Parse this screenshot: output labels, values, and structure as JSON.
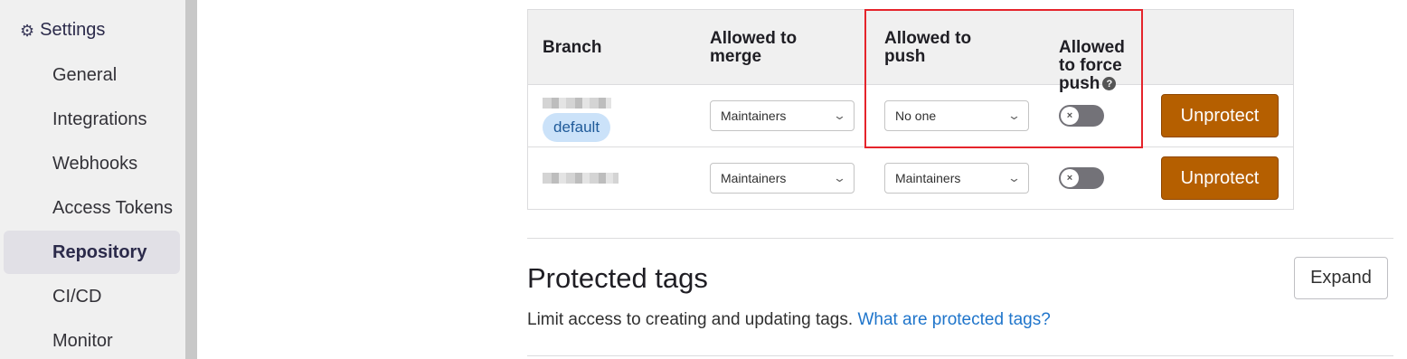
{
  "sidebar": {
    "header": "Settings",
    "items": [
      {
        "label": "General"
      },
      {
        "label": "Integrations"
      },
      {
        "label": "Webhooks"
      },
      {
        "label": "Access Tokens"
      },
      {
        "label": "Repository",
        "active": true
      },
      {
        "label": "CI/CD"
      },
      {
        "label": "Monitor"
      }
    ]
  },
  "table": {
    "headers": {
      "branch": "Branch",
      "merge": "Allowed to\nmerge",
      "push": "Allowed to\npush",
      "force": "Allowed\nto force\npush"
    },
    "rows": [
      {
        "badge": "default",
        "merge": "Maintainers",
        "push": "No one",
        "unprotect": "Unprotect"
      },
      {
        "merge": "Maintainers",
        "push": "Maintainers",
        "unprotect": "Unprotect"
      }
    ]
  },
  "protected_tags": {
    "title": "Protected tags",
    "description": "Limit access to creating and updating tags.",
    "link": "What are protected tags?",
    "expand": "Expand"
  },
  "colors": {
    "unprotect_button": "#b55f00",
    "highlight": "#e5242b",
    "link": "#1f75cb"
  }
}
